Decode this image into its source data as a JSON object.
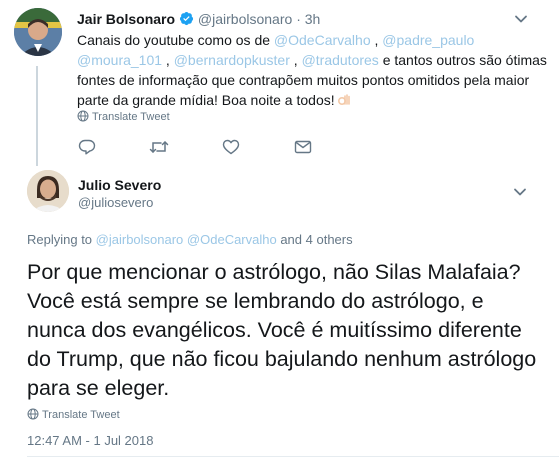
{
  "tweet1": {
    "author_name": "Jair Bolsonaro",
    "handle": "@jairbolsonaro",
    "separator": "·",
    "time": "3h",
    "text_parts": {
      "p0": "Canais do youtube como os de ",
      "m0": "@OdeCarvalho",
      "p1": " , ",
      "m1": "@padre_paulo",
      "m2": "@moura_101",
      "p2": " , ",
      "m3": "@bernardopkuster",
      "p3": " , ",
      "m4": "@tradutores",
      "p4": " e tantos outros são ótimas fontes de informação que contrapõem muitos pontos omitidos pela maior parte da grande mídia! Boa noite a todos!"
    },
    "translate_label": "Translate Tweet",
    "icons": [
      "reply-icon",
      "retweet-icon",
      "like-icon",
      "dm-icon"
    ]
  },
  "tweet2": {
    "author_name": "Julio Severo",
    "handle": "@juliosevero",
    "replying": {
      "prefix": "Replying to ",
      "m1": "@jairbolsonaro",
      "m2": "@OdeCarvalho",
      "suffix": " and 4 others"
    },
    "text": "Por que mencionar o astrólogo, não Silas Malafaia? Você está sempre se lembrando do astrólogo, e nunca dos evangélicos. Você é muitíssimo diferente do Trump, que não ficou bajulando nenhum astrólogo para se eleger.",
    "translate_label": "Translate Tweet",
    "timestamp": "12:47 AM - 1 Jul 2018"
  },
  "colors": {
    "link": "#1b95e0",
    "muted_link": "#9bc7e6",
    "secondary_text": "#657786",
    "verified": "#1da1f2"
  }
}
